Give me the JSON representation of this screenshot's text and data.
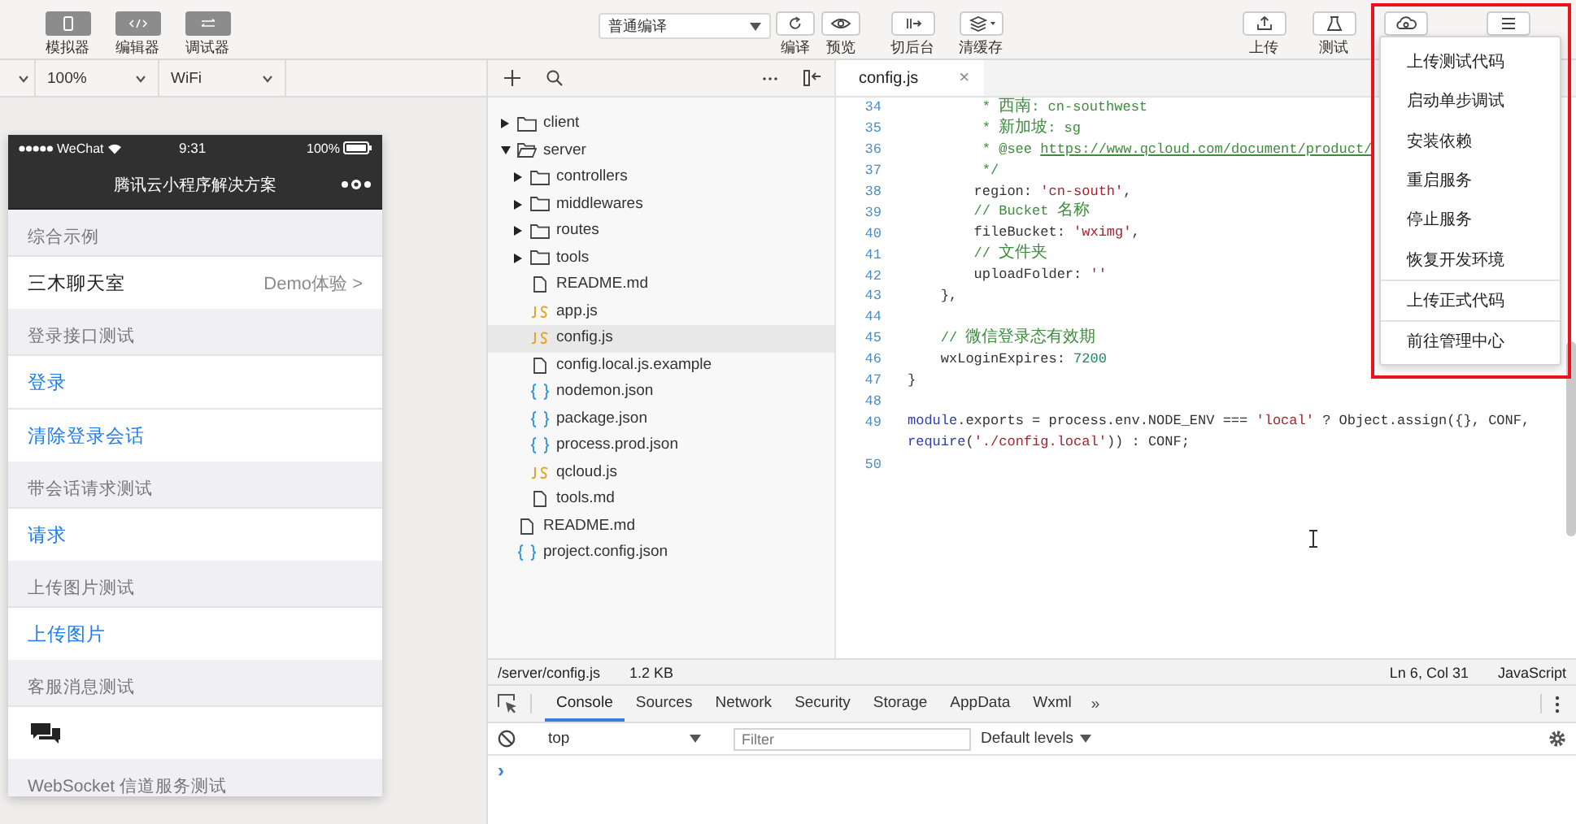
{
  "toolbar": {
    "left_buttons": [
      {
        "label": "模拟器",
        "kind": "phone"
      },
      {
        "label": "编辑器",
        "kind": "code"
      },
      {
        "label": "调试器",
        "kind": "debug"
      }
    ],
    "compile_mode": {
      "value": "普通编译"
    },
    "center_buttons": [
      {
        "label": "编译",
        "kind": "refresh"
      },
      {
        "label": "预览",
        "kind": "eye"
      },
      {
        "label": "切后台",
        "kind": "switch"
      },
      {
        "label": "清缓存",
        "kind": "layers"
      }
    ],
    "right_buttons": [
      {
        "label": "上传",
        "kind": "upload"
      },
      {
        "label": "测试",
        "kind": "flask"
      },
      {
        "kind": "cloud"
      },
      {
        "kind": "menu"
      }
    ]
  },
  "simulator_settings": {
    "zoom": "100%",
    "network": "WiFi"
  },
  "phone": {
    "status": {
      "carrier": "WeChat",
      "time": "9:31",
      "battery": "100%"
    },
    "title": "腾讯云小程序解决方案",
    "sections": [
      {
        "header": "综合示例",
        "rows": [
          {
            "kind": "nav",
            "label": "三木聊天室",
            "detail": "Demo体验 >"
          }
        ]
      },
      {
        "header": "登录接口测试",
        "rows": [
          {
            "kind": "action",
            "label": "登录"
          },
          {
            "kind": "action",
            "label": "清除登录会话"
          }
        ]
      },
      {
        "header": "带会话请求测试",
        "rows": [
          {
            "kind": "action",
            "label": "请求"
          }
        ]
      },
      {
        "header": "上传图片测试",
        "rows": [
          {
            "kind": "action",
            "label": "上传图片"
          }
        ]
      },
      {
        "header": "客服消息测试",
        "rows": [
          {
            "kind": "chat"
          }
        ]
      },
      {
        "header": "WebSocket 信道服务测试"
      }
    ]
  },
  "file_tree": {
    "items": [
      {
        "name": "client",
        "kind": "folder",
        "expanded": false,
        "selected": false
      },
      {
        "name": "server",
        "kind": "folder",
        "expanded": true,
        "selected": false,
        "children": [
          {
            "name": "controllers",
            "kind": "folder",
            "expanded": false,
            "selected": false
          },
          {
            "name": "middlewares",
            "kind": "folder",
            "expanded": false,
            "selected": false
          },
          {
            "name": "routes",
            "kind": "folder",
            "expanded": false,
            "selected": false
          },
          {
            "name": "tools",
            "kind": "folder",
            "expanded": false,
            "selected": false
          },
          {
            "name": "README.md",
            "kind": "file",
            "selected": false
          },
          {
            "name": "app.js",
            "kind": "js",
            "selected": false
          },
          {
            "name": "config.js",
            "kind": "js",
            "selected": true
          },
          {
            "name": "config.local.js.example",
            "kind": "file",
            "selected": false
          },
          {
            "name": "nodemon.json",
            "kind": "json",
            "selected": false
          },
          {
            "name": "package.json",
            "kind": "json",
            "selected": false
          },
          {
            "name": "process.prod.json",
            "kind": "json",
            "selected": false
          },
          {
            "name": "qcloud.js",
            "kind": "js",
            "selected": false
          },
          {
            "name": "tools.md",
            "kind": "file",
            "selected": false
          }
        ]
      },
      {
        "name": "README.md",
        "kind": "file",
        "selected": false
      },
      {
        "name": "project.config.json",
        "kind": "json",
        "selected": false
      }
    ]
  },
  "editor": {
    "tabs": [
      {
        "label": "config.js",
        "close": "×",
        "selected": true
      }
    ],
    "lines": [
      {
        "number": "34",
        "tokens": [
          {
            "kind": "comment",
            "text": "         * 西南: cn-southwest"
          }
        ]
      },
      {
        "number": "35",
        "tokens": [
          {
            "kind": "comment",
            "text": "         * 新加坡: sg"
          }
        ]
      },
      {
        "number": "36",
        "tokens": [
          {
            "kind": "comment",
            "text": "         * @see "
          },
          {
            "kind": "link",
            "text": "https://www.qcloud.com/document/product/"
          }
        ]
      },
      {
        "number": "37",
        "tokens": [
          {
            "kind": "comment",
            "text": "         */"
          }
        ]
      },
      {
        "number": "38",
        "tokens": [
          {
            "kind": "plain",
            "text": "        region: "
          },
          {
            "kind": "string",
            "text": "'cn-south'"
          },
          {
            "kind": "plain",
            "text": ","
          }
        ]
      },
      {
        "number": "39",
        "tokens": [
          {
            "kind": "comment",
            "text": "        // Bucket 名称"
          }
        ]
      },
      {
        "number": "40",
        "tokens": [
          {
            "kind": "plain",
            "text": "        fileBucket: "
          },
          {
            "kind": "string",
            "text": "'wximg'"
          },
          {
            "kind": "plain",
            "text": ","
          }
        ]
      },
      {
        "number": "41",
        "tokens": [
          {
            "kind": "comment",
            "text": "        // 文件夹"
          }
        ]
      },
      {
        "number": "42",
        "tokens": [
          {
            "kind": "plain",
            "text": "        uploadFolder: "
          },
          {
            "kind": "string",
            "text": "''"
          }
        ]
      },
      {
        "number": "43",
        "tokens": [
          {
            "kind": "plain",
            "text": "    },"
          }
        ]
      },
      {
        "number": "44"
      },
      {
        "number": "45",
        "tokens": [
          {
            "kind": "comment",
            "text": "    // 微信登录态有效期"
          }
        ]
      },
      {
        "number": "46",
        "tokens": [
          {
            "kind": "plain",
            "text": "    wxLoginExpires: "
          },
          {
            "kind": "number",
            "text": "7200"
          }
        ]
      },
      {
        "number": "47",
        "tokens": [
          {
            "kind": "plain",
            "text": "}"
          }
        ]
      },
      {
        "number": "48"
      },
      {
        "number": "49",
        "tokens": [
          {
            "kind": "keyword",
            "text": "module"
          },
          {
            "kind": "plain",
            "text": ".exports = process.env.NODE_ENV === "
          },
          {
            "kind": "string",
            "text": "'local'"
          },
          {
            "kind": "plain",
            "text": " ? Object.assign({}, CONF,"
          }
        ],
        "wrapped_tokens": [
          {
            "kind": "keyword",
            "text": "require"
          },
          {
            "kind": "plain",
            "text": "("
          },
          {
            "kind": "string",
            "text": "'./config.local'"
          },
          {
            "kind": "plain",
            "text": ")) : CONF;"
          }
        ]
      },
      {
        "number": "50"
      }
    ]
  },
  "status_bar": {
    "path": "/server/config.js",
    "size": "1.2 KB",
    "position": "Ln 6, Col 31",
    "language": "JavaScript"
  },
  "devtools": {
    "tabs": [
      {
        "label": "Console",
        "selected": true
      },
      {
        "label": "Sources",
        "selected": false
      },
      {
        "label": "Network",
        "selected": false
      },
      {
        "label": "Security",
        "selected": false
      },
      {
        "label": "Storage",
        "selected": false
      },
      {
        "label": "AppData",
        "selected": false
      },
      {
        "label": "Wxml",
        "selected": false
      }
    ],
    "overflow": "»",
    "context": "top",
    "filter_placeholder": "Filter",
    "levels": "Default levels",
    "prompt": "›"
  },
  "menu": {
    "groups": [
      {
        "items": [
          "上传测试代码",
          "启动单步调试",
          "安装依赖",
          "重启服务",
          "停止服务",
          "恢复开发环境"
        ]
      },
      {
        "items": [
          "上传正式代码"
        ]
      },
      {
        "items": [
          "前往管理中心"
        ]
      }
    ]
  }
}
